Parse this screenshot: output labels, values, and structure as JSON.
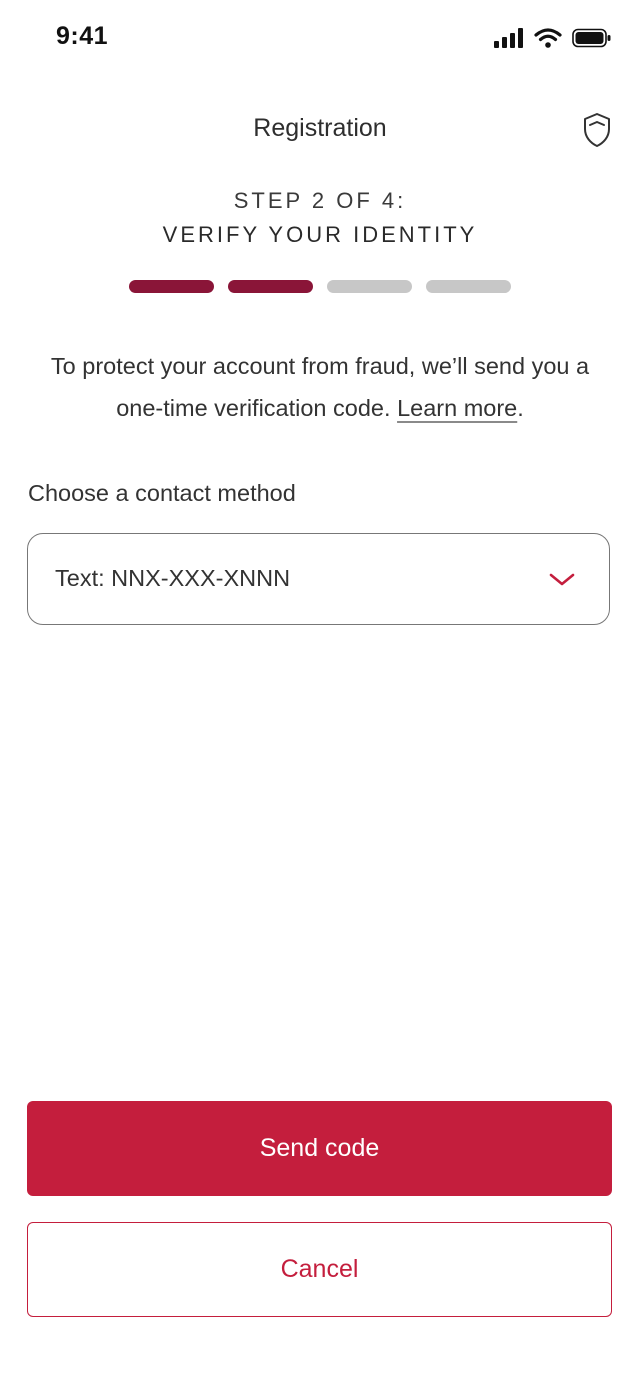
{
  "status_bar": {
    "time": "9:41",
    "icons": [
      "signal-icon",
      "wifi-icon",
      "battery-icon"
    ]
  },
  "header": {
    "title": "Registration",
    "icon": "shield-icon"
  },
  "step": {
    "line1": "STEP 2 OF 4:",
    "line2": "VERIFY YOUR IDENTITY",
    "current": 2,
    "total": 4
  },
  "intro": {
    "text": "To protect your account from fraud, we’ll send you a one-time verification code.",
    "link_label": "Learn more",
    "after_link": "."
  },
  "contact": {
    "label": "Choose a contact method",
    "selected": "Text: NNX-XXX-XNNN"
  },
  "actions": {
    "send_label": "Send code",
    "cancel_label": "Cancel"
  },
  "colors": {
    "accent": "#c41e3d",
    "progress_active": "#8a1538",
    "progress_inactive": "#c7c7c7"
  }
}
